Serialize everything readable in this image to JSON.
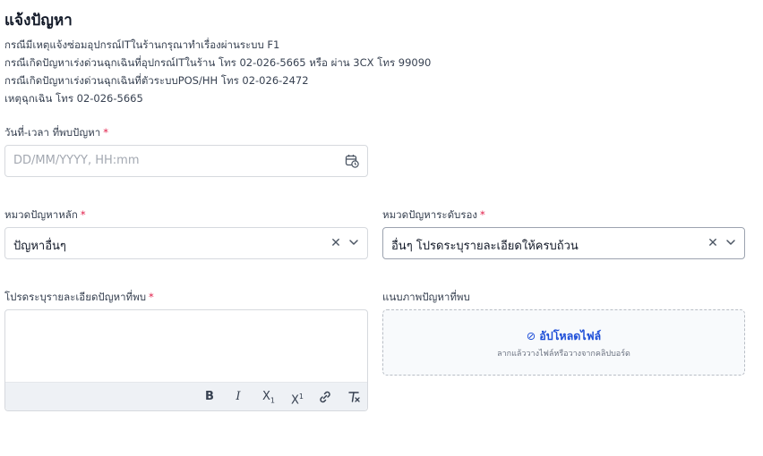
{
  "page": {
    "title": "แจ้งปัญหา",
    "info_lines": [
      "กรณีมีเหตุแจ้งซ่อมอุปกรณ์ITในร้านกรุณาทำเรื่องผ่านระบบ F1",
      "กรณีเกิดปัญหาเร่งด่วนฉุกเฉินที่อุปกรณ์ITในร้าน โทร 02-026-5665 หรือ ผ่าน 3CX โทร 99090",
      "กรณีเกิดปัญหาเร่งด่วนฉุกเฉินที่ตัวระบบPOS/HH โทร 02-026-2472",
      "เหตุฉุกเฉิน โทร 02-026-5665"
    ]
  },
  "form": {
    "datetime": {
      "label": "วันที่-เวลา ที่พบปัญหา",
      "required_mark": "*",
      "placeholder": "DD/MM/YYYY, HH:mm",
      "icon": "calendar-clock-icon"
    },
    "main_category": {
      "label": "หมวดปัญหาหลัก",
      "required_mark": "*",
      "value": "ปัญหาอื่นๆ",
      "clear_icon": "clear-icon",
      "chevron_icon": "chevron-down-icon"
    },
    "sub_category": {
      "label": "หมวดปัญหาระดับรอง",
      "required_mark": "*",
      "value": "อื่นๆ โปรดระบุรายละเอียดให้ครบถ้วน",
      "clear_icon": "clear-icon",
      "chevron_icon": "chevron-down-icon"
    },
    "details": {
      "label": "โปรดระบุรายละเอียดปัญหาที่พบ",
      "required_mark": "*",
      "value": "",
      "toolbar": [
        "bold-icon",
        "italic-icon",
        "subscript-icon",
        "superscript-icon",
        "link-icon",
        "clear-format-icon"
      ]
    },
    "attachment": {
      "label": "แนบภาพปัญหาที่พบ",
      "upload_label": "อัปโหลดไฟล์",
      "upload_hint": "ลากแล้ววางไฟล์หรือวางจากคลิปบอร์ด",
      "icon": "paperclip-icon"
    }
  },
  "colors": {
    "required": "#e11d48",
    "upload_link": "#1d4ed8",
    "toolbar_bg": "#eef1f5"
  }
}
